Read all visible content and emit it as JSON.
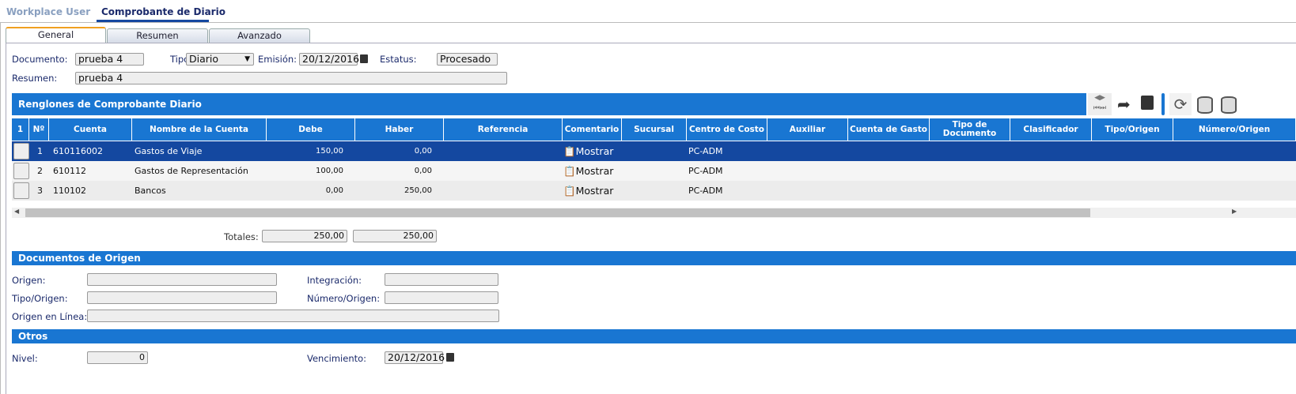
{
  "top_tabs": [
    "Workplace User",
    "Comprobante de Diario"
  ],
  "sub_tabs": [
    "General",
    "Resumen",
    "Avanzado"
  ],
  "header": {
    "documento_label": "Documento:",
    "documento": "prueba 4",
    "tipo_label": "Tipo:",
    "tipo": "Diario",
    "emision_label": "Emisión:",
    "emision": "20/12/2016",
    "estatus_label": "Estatus:",
    "estatus": "Procesado",
    "resumen_label": "Resumen:",
    "resumen": "prueba 4"
  },
  "grid": {
    "title": "Renglones de Comprobante Diario",
    "columns": [
      "1",
      "Nº",
      "Cuenta",
      "Nombre de la Cuenta",
      "Debe",
      "Haber",
      "Referencia",
      "Comentario",
      "Sucursal",
      "Centro de Costo",
      "Auxiliar",
      "Cuenta de Gasto",
      "Tipo de Documento",
      "Clasificador",
      "Tipo/Origen",
      "Número/Origen"
    ],
    "rows": [
      {
        "n": "1",
        "cuenta": "610116002",
        "nombre": "Gastos de Viaje",
        "debe": "150,00",
        "haber": "0,00",
        "comentario": "Mostrar",
        "centro": "PC-ADM"
      },
      {
        "n": "2",
        "cuenta": "610112",
        "nombre": "Gastos de Representación",
        "debe": "100,00",
        "haber": "0,00",
        "comentario": "Mostrar",
        "centro": "PC-ADM"
      },
      {
        "n": "3",
        "cuenta": "110102",
        "nombre": "Bancos",
        "debe": "0,00",
        "haber": "250,00",
        "comentario": "Mostrar",
        "centro": "PC-ADM"
      }
    ],
    "totales_label": "Totales:",
    "total_debe": "250,00",
    "total_haber": "250,00"
  },
  "origen": {
    "title": "Documentos de Origen",
    "origen_label": "Origen:",
    "origen": "",
    "integracion_label": "Integración:",
    "integracion": "",
    "tipo_origen_label": "Tipo/Origen:",
    "tipo_origen": "",
    "numero_origen_label": "Número/Origen:",
    "numero_origen": "",
    "linea_label": "Origen en Línea:",
    "linea": ""
  },
  "otros": {
    "title": "Otros",
    "nivel_label": "Nivel:",
    "nivel": "0",
    "vencimiento_label": "Vencimiento:",
    "vencimiento": "20/12/2016"
  },
  "colors": {
    "header_blue": "#1976d2",
    "selected_row": "#1448a0"
  }
}
